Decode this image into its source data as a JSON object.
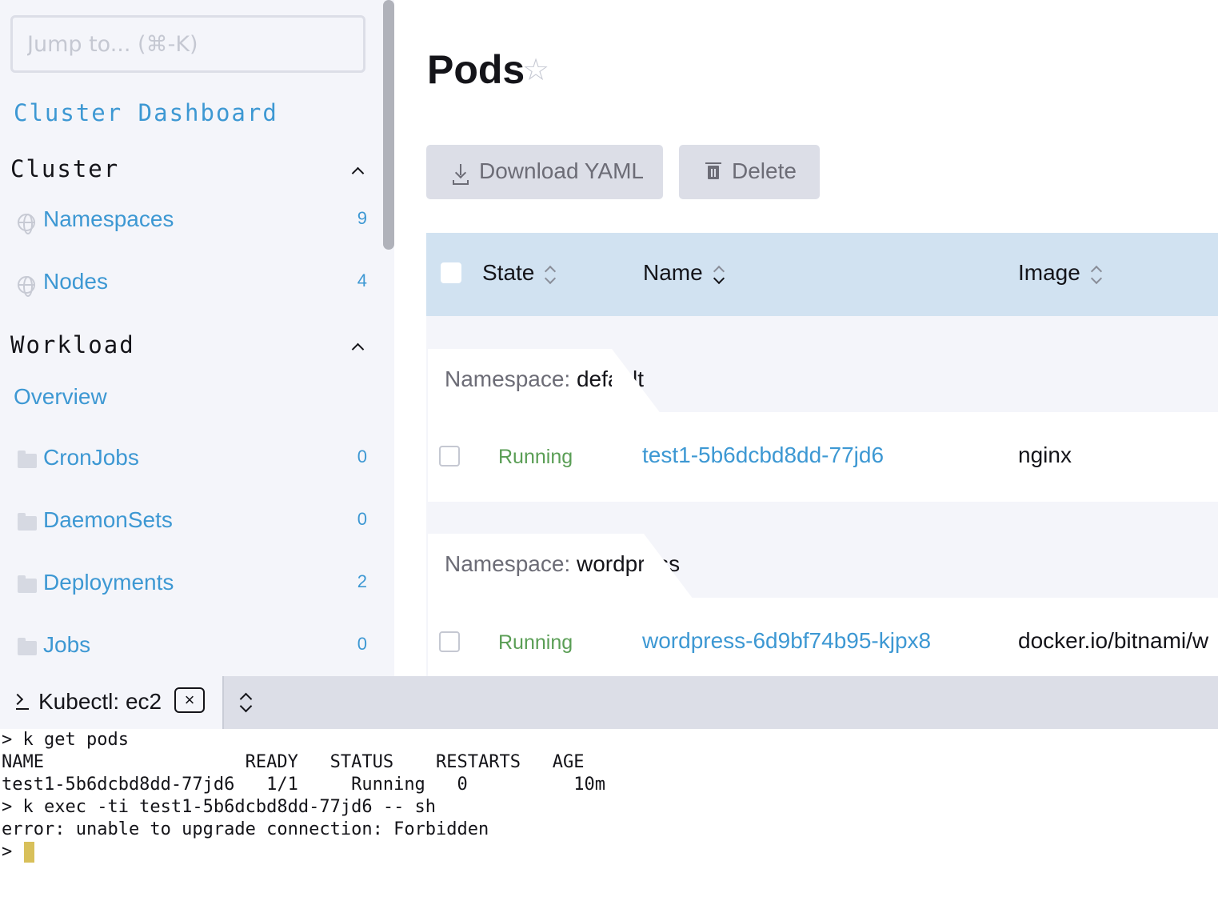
{
  "sidebar": {
    "jump_placeholder": "Jump to... (⌘-K)",
    "cluster_dashboard": "Cluster Dashboard",
    "groups": [
      {
        "label": "Cluster",
        "items": [
          {
            "label": "Namespaces",
            "count": "9",
            "icon": "globe-icon"
          },
          {
            "label": "Nodes",
            "count": "4",
            "icon": "globe-icon"
          }
        ]
      },
      {
        "label": "Workload",
        "overview": "Overview",
        "items": [
          {
            "label": "CronJobs",
            "count": "0",
            "icon": "folder-icon"
          },
          {
            "label": "DaemonSets",
            "count": "0",
            "icon": "folder-icon"
          },
          {
            "label": "Deployments",
            "count": "2",
            "icon": "folder-icon"
          },
          {
            "label": "Jobs",
            "count": "0",
            "icon": "folder-icon"
          }
        ]
      }
    ]
  },
  "main": {
    "title": "Pods",
    "actions": {
      "download": "Download YAML",
      "delete": "Delete"
    },
    "table": {
      "columns": [
        "State",
        "Name",
        "Image"
      ],
      "groups": [
        {
          "label": "Namespace:",
          "value": "default",
          "rows": [
            {
              "state": "Running",
              "name": "test1-5b6dcbd8dd-77jd6",
              "image": "nginx"
            }
          ]
        },
        {
          "label": "Namespace:",
          "value": "wordpress",
          "rows": [
            {
              "state": "Running",
              "name": "wordpress-6d9bf74b95-kjpx8",
              "image": "docker.io/bitnami/w"
            }
          ]
        }
      ]
    }
  },
  "terminal": {
    "tab_label": "Kubectl: ec2",
    "close": "×",
    "lines": [
      "> k get pods",
      "NAME                   READY   STATUS    RESTARTS   AGE",
      "test1-5b6dcbd8dd-77jd6   1/1     Running   0          10m",
      "> k exec -ti test1-5b6dcbd8dd-77jd6 -- sh",
      "error: unable to upgrade connection: Forbidden",
      "> "
    ]
  },
  "colors": {
    "link": "#3d98d3",
    "running": "#5a9e55",
    "header_bg": "#d1e2f1",
    "sidebar_bg": "#f4f5fa",
    "cursor": "#d8c05a"
  }
}
